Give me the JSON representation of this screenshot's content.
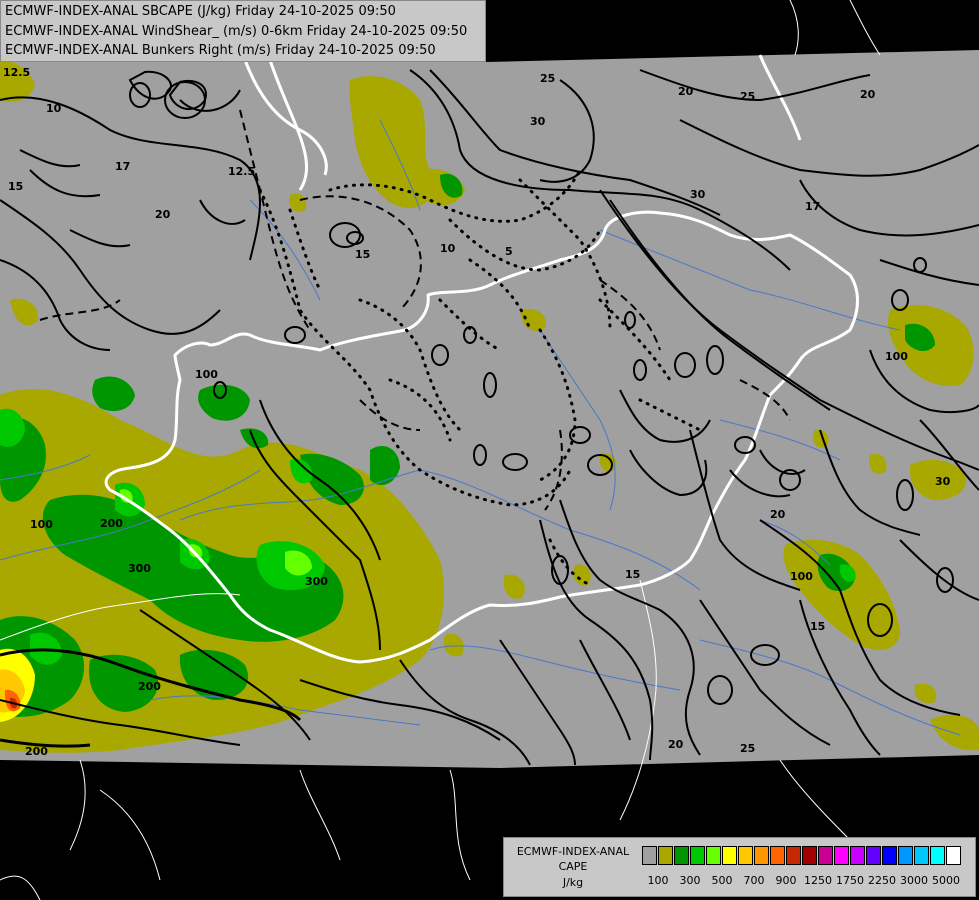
{
  "header": {
    "line1": "ECMWF-INDEX-ANAL SBCAPE (J/kg) Friday 24-10-2025 09:50",
    "line2": "ECMWF-INDEX-ANAL WindShear_ (m/s) 0-6km Friday 24-10-2025 09:50",
    "line3": "ECMWF-INDEX-ANAL Bunkers Right (m/s) Friday 24-10-2025 09:50"
  },
  "legend": {
    "title1": "ECMWF-INDEX-ANAL",
    "title2": "CAPE",
    "title3": "J/kg",
    "colors": [
      "#a0a0a0",
      "#a8a800",
      "#009600",
      "#00c800",
      "#64ff00",
      "#ffff00",
      "#ffc800",
      "#ff9600",
      "#ff6400",
      "#c82800",
      "#a00000",
      "#c80096",
      "#ff00ff",
      "#c800ff",
      "#6400ff",
      "#0000ff",
      "#0096ff",
      "#00c8ff",
      "#00ffff",
      "#ffffff"
    ],
    "ticks": [
      "100",
      "300",
      "500",
      "700",
      "900",
      "1250",
      "1750",
      "2250",
      "3000",
      "5000"
    ]
  },
  "map": {
    "contour_labels": [
      "12.5",
      "10",
      "15",
      "17",
      "20",
      "25",
      "30",
      "12.5",
      "15",
      "10",
      "5",
      "15",
      "20",
      "25",
      "30",
      "20",
      "17",
      "15",
      "20",
      "25",
      "30",
      "100",
      "200",
      "300",
      "200",
      "100",
      "300",
      "200",
      "100",
      "100",
      "20",
      "30"
    ]
  },
  "colors": {
    "background": "#000000",
    "domain_gray": "#a0a0a0",
    "border": "#ffffff",
    "rivers": "#4a78c8",
    "contours": "#000000"
  }
}
